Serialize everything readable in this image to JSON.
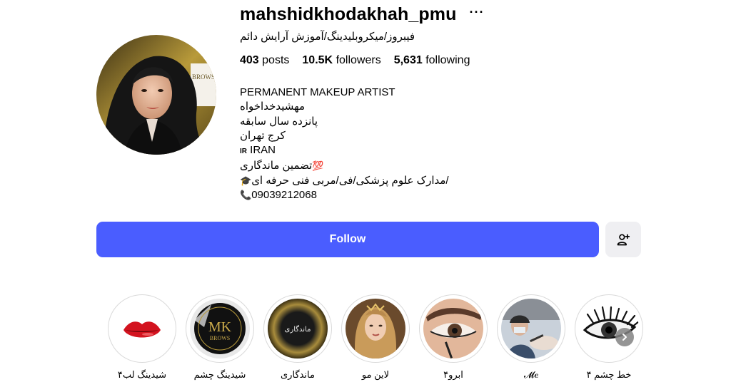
{
  "profile": {
    "username": "mahshidkhodakhah_pmu",
    "more_icon": "···",
    "full_name": "فیبروز/میکروبلیدینگ/آموزش آرایش دائم",
    "stats": {
      "posts_count": "403",
      "posts_label": "posts",
      "followers_count": "10.5K",
      "followers_label": "followers",
      "following_count": "5,631",
      "following_label": "following"
    },
    "bio": {
      "line1": "PERMANENT MAKEUP ARTIST",
      "line2": "مهشیدخداخواه",
      "line3": "پانزده سال سابقه",
      "line4": "کرج تهران",
      "line5_flag": "IR",
      "line5_text": "IRAN",
      "line6_emoji": "💯",
      "line6_text": "تضمین ماندگاری",
      "line7_emoji": "🎓",
      "line7_text": "/مدارک علوم پزشکی/فی/مربی فنی حرفه ای",
      "line8_emoji": "📞",
      "line8_text": "09039212068"
    },
    "avatar_text": "BROWS"
  },
  "actions": {
    "follow_label": "Follow",
    "suggest_icon": "person-add-icon",
    "accent_color": "#4a5dff"
  },
  "highlights": [
    {
      "label": "شیدینگ لب۴",
      "image": "red-lips"
    },
    {
      "label": "شیدینگ چشم",
      "image": "mk-brows-logo",
      "logo_text": "MK",
      "logo_sub": "BROWS"
    },
    {
      "label": "ماندگاری",
      "image": "dark-gold-circle",
      "inner_text": "ماندگاری"
    },
    {
      "label": "لاین مو",
      "image": "woman-portrait"
    },
    {
      "label": "ابرو۴",
      "image": "eye-closeup"
    },
    {
      "label": "𝓜𝒆",
      "image": "artist-working"
    },
    {
      "label": "خط چشم ۴",
      "image": "eyelash-illustration"
    }
  ]
}
